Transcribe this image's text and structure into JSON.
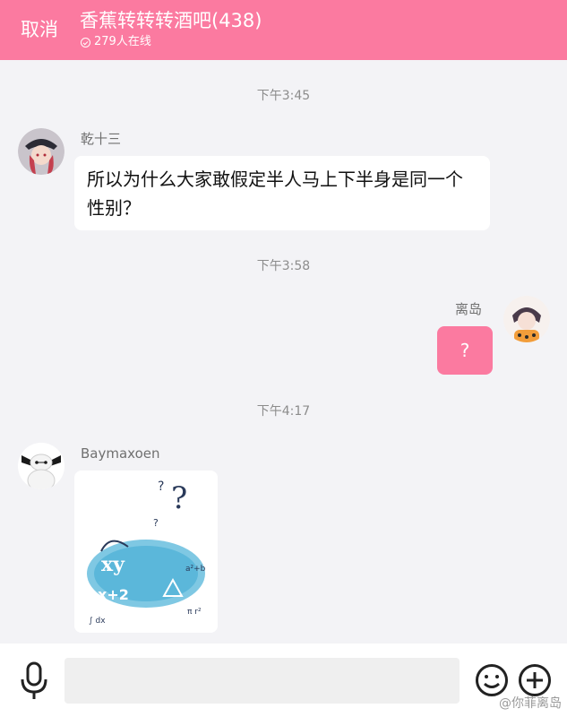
{
  "header": {
    "cancel_label": "取消",
    "title": "香蕉转转转酒吧(438)",
    "online_text": "279人在线"
  },
  "messages": [
    {
      "timestamp": "下午3:45",
      "sender": "乾十三",
      "text": "所以为什么大家敢假定半人马上下半身是同一个性别？",
      "side": "left"
    },
    {
      "timestamp": "下午3:58",
      "sender": "离岛",
      "text": "?",
      "side": "right"
    },
    {
      "timestamp": "下午4:17",
      "sender": "Baymaxoen",
      "image": "question-sticker",
      "side": "left"
    }
  ],
  "bottom": {
    "input_placeholder": "",
    "icons": [
      "microphone-icon",
      "emoji-icon",
      "plus-icon"
    ]
  },
  "watermark": "@你菲离岛",
  "colors": {
    "accent": "#fb7aa0",
    "background": "#f3f3f6"
  }
}
